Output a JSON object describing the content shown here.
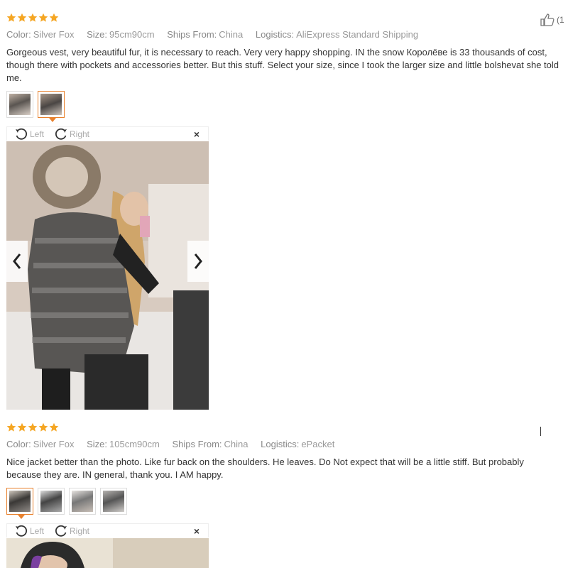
{
  "reviews": [
    {
      "stars": 5,
      "helpful_count": "(1",
      "color_label": "Color:",
      "color_value": "Silver Fox",
      "size_label": "Size:",
      "size_value": "95cm90cm",
      "ships_label": "Ships From:",
      "ships_value": "China",
      "logistics_label": "Logistics:",
      "logistics_value": "AliExpress Standard Shipping",
      "text": "Gorgeous vest, very beautiful fur, it is necessary to reach. Very very happy shopping. IN the snow Королёве is 33 thousands of cost, though there with pockets and accessories better. But this stuff. Select your size, since I took the larger size and little bolshevat she told me.",
      "thumbnail_count": 2,
      "active_thumbnail": 2,
      "viewer": {
        "rotate_left": "Left",
        "rotate_right": "Right",
        "close": "×"
      }
    },
    {
      "stars": 5,
      "color_label": "Color:",
      "color_value": "Silver Fox",
      "size_label": "Size:",
      "size_value": "105cm90cm",
      "ships_label": "Ships From:",
      "ships_value": "China",
      "logistics_label": "Logistics:",
      "logistics_value": "ePacket",
      "text": "Nice jacket better than the photo. Like fur back on the shoulders. He leaves. Do Not expect that will be a little stiff. But probably because they are. IN general, thank you. I AM happy.",
      "thumbnail_count": 4,
      "active_thumbnail": 1,
      "viewer": {
        "rotate_left": "Left",
        "rotate_right": "Right",
        "close": "×"
      }
    }
  ],
  "colors": {
    "star": "#f5a623",
    "accent": "#e8812d"
  }
}
